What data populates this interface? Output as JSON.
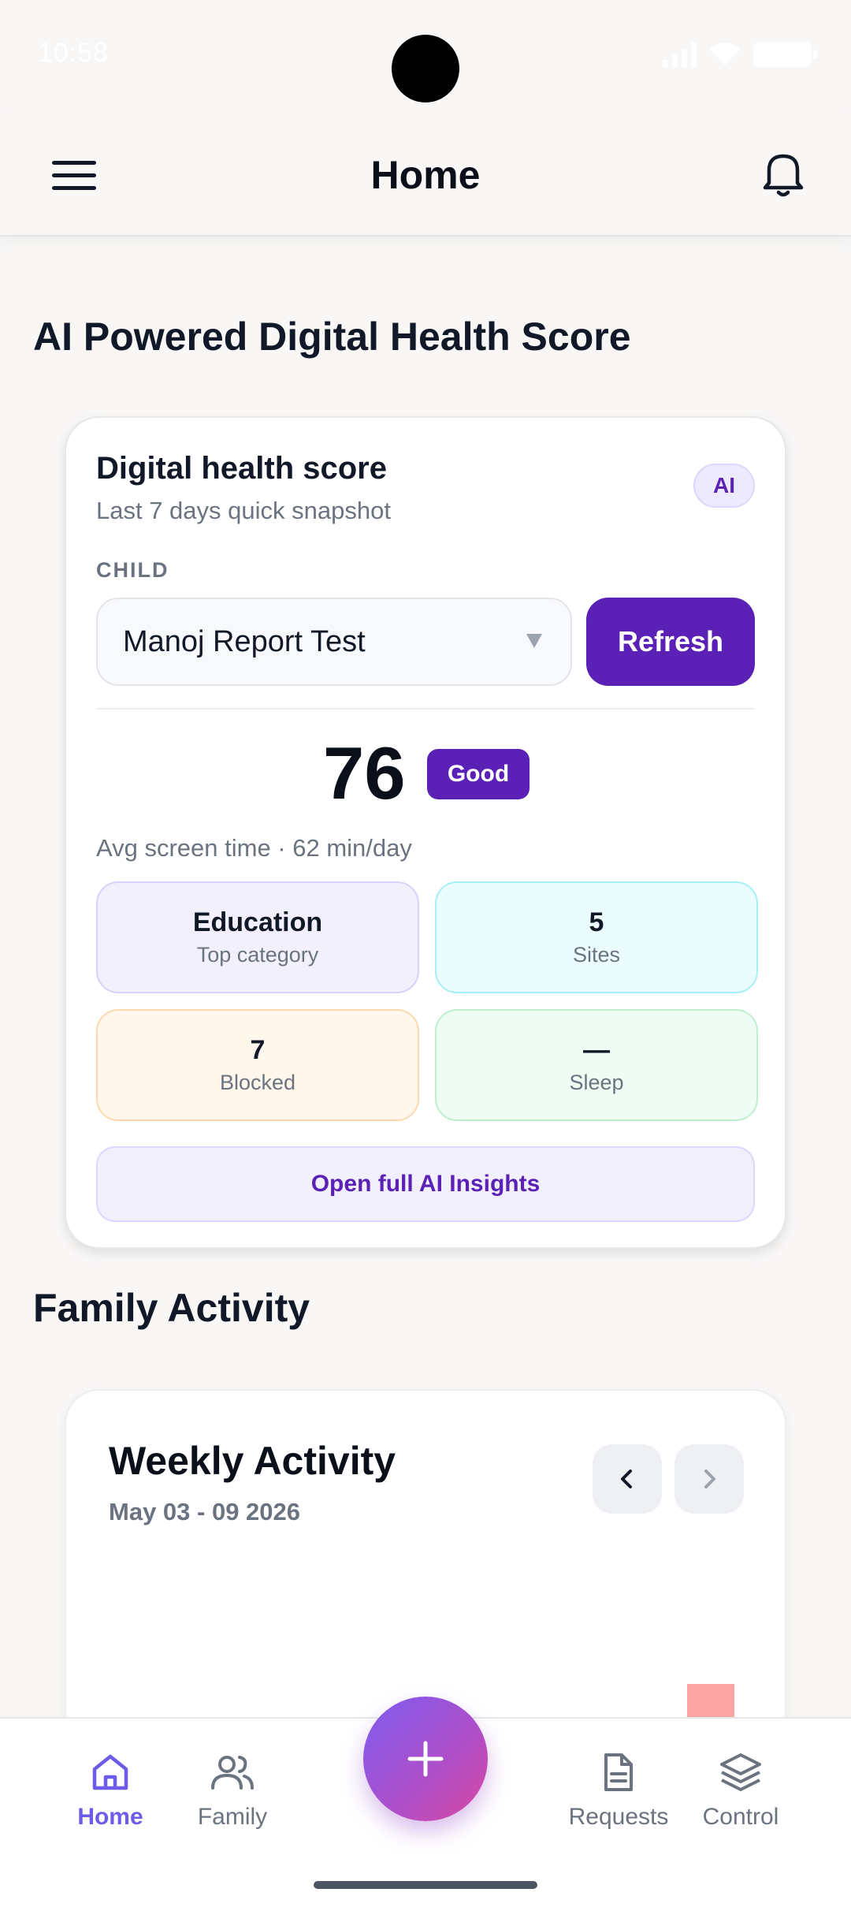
{
  "status_bar": {
    "time": "10:58"
  },
  "header": {
    "title": "Home"
  },
  "sections": {
    "health": "AI Powered Digital Health Score",
    "family": "Family Activity"
  },
  "health_card": {
    "title": "Digital health score",
    "subtitle": "Last 7 days quick snapshot",
    "ai_badge": "AI",
    "child_label": "CHILD",
    "child_value": "Manoj Report Test",
    "refresh_label": "Refresh",
    "score": "76",
    "score_label": "Good",
    "avg_screen_time": "Avg screen time · 62 min/day",
    "tiles": {
      "top_category": {
        "value": "Education",
        "label": "Top category"
      },
      "sites": {
        "value": "5",
        "label": "Sites"
      },
      "blocked": {
        "value": "7",
        "label": "Blocked"
      },
      "sleep": {
        "value": "—",
        "label": "Sleep"
      }
    },
    "insights_button": "Open full AI Insights"
  },
  "weekly_card": {
    "title": "Weekly Activity",
    "date_range": "May 03 - 09 2026"
  },
  "chart_data": {
    "type": "bar",
    "title": "Weekly Activity",
    "bar_color": "#f9a3a3",
    "values_visible_fraction": [
      0,
      0,
      0,
      0,
      0,
      0.18,
      0.8
    ]
  },
  "bottom_nav": {
    "items": [
      {
        "label": "Home",
        "icon": "home-icon",
        "active": true
      },
      {
        "label": "Family",
        "icon": "family-icon",
        "active": false
      },
      {
        "label": "Requests",
        "icon": "document-icon",
        "active": false
      },
      {
        "label": "Control",
        "icon": "layers-icon",
        "active": false
      }
    ],
    "fab_icon": "plus-icon"
  },
  "colors": {
    "accent": "#5b21b6",
    "nav_active": "#6d5ce7",
    "background": "#f8f7f6"
  }
}
